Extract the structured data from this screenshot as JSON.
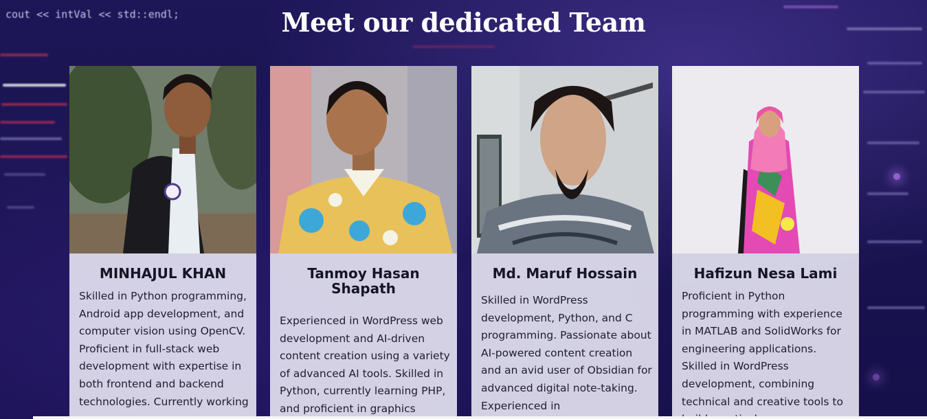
{
  "page": {
    "title": "Meet our dedicated Team"
  },
  "background": {
    "code_snippet": "cout << intVal << std::endl;"
  },
  "team": [
    {
      "name": "MINHAJUL KHAN",
      "photo_icon": "person-portrait-icon",
      "bio": "Skilled in Python programming, Android app development, and computer vision using OpenCV. Proficient in full-stack web development with expertise in both frontend and backend technologies. Currently working"
    },
    {
      "name": "Tanmoy Hasan Shapath",
      "photo_icon": "person-portrait-icon",
      "bio": "Experienced in WordPress web development and AI-driven content creation using a variety of advanced AI tools. Skilled in Python, currently learning PHP, and proficient in graphics"
    },
    {
      "name": "Md. Maruf Hossain",
      "photo_icon": "person-portrait-icon",
      "bio": "Skilled in WordPress development, Python, and C programming. Passionate about AI-powered content creation and an avid user of Obsidian for advanced digital note-taking. Experienced in"
    },
    {
      "name": "Hafizun Nesa Lami",
      "photo_icon": "person-portrait-icon",
      "bio": "Proficient in Python programming with experience in MATLAB and SolidWorks for engineering applications. Skilled in WordPress development, combining technical and creative tools to build practical"
    }
  ],
  "colors": {
    "background": "#17134a",
    "heading": "#ffffff",
    "card": "#e8e5f4",
    "text": "#151524"
  }
}
